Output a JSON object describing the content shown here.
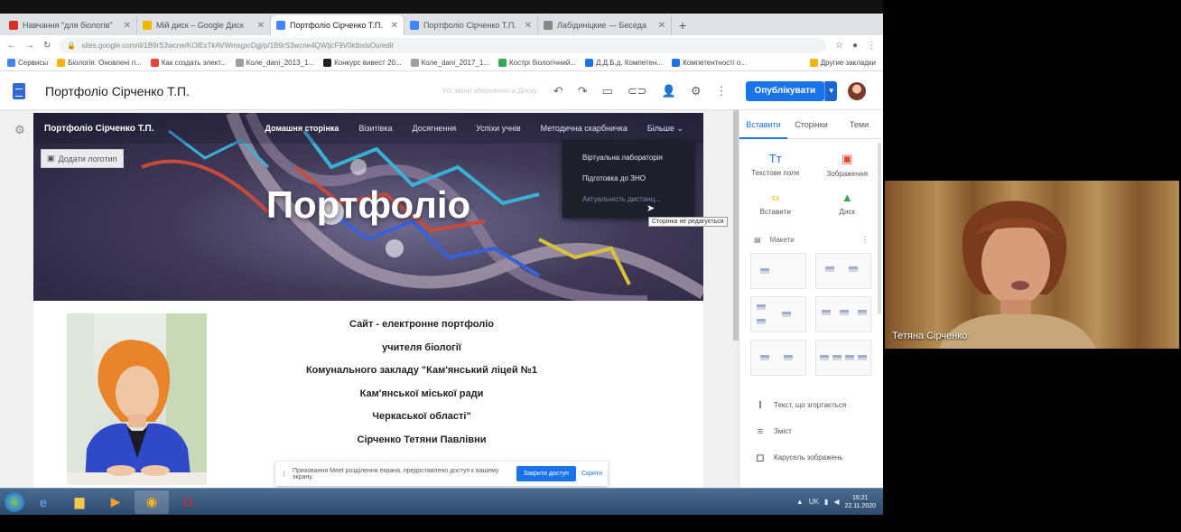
{
  "browser": {
    "tabs": [
      {
        "label": "Навчання \"для біологів\"",
        "color": "#d93025",
        "active": false
      },
      {
        "label": "Мій диск – Google Диск",
        "color": "#f4b400",
        "active": false
      },
      {
        "label": "Портфоліо Сірченко Т.П.",
        "color": "#4285f4",
        "active": true
      },
      {
        "label": "Портфоліо Сірченко Т.П.",
        "color": "#4285f4",
        "active": false
      },
      {
        "label": "Лабідиніцкие — Беседа",
        "color": "#888888",
        "active": false
      }
    ],
    "url": "sites.google.com/d/1B9rS3wcne/KOlExTkAVWmsgxrDgj/p/1B9rS3wcne4QWtjcF9V0ktbxlsOu/edit",
    "bookmarks": [
      "Сервисы",
      "Біологія. Оновлені п...",
      "Как создать элект...",
      "Коле_danі_2013_1...",
      "Конкурс вивест 20...",
      "Коле_danі_2017_1...",
      "Кострі біологічний...",
      "Д.Д.Б.д. Компетен...",
      "Компетентності о...",
      "Другие закладки"
    ]
  },
  "sites_toolbar": {
    "title": "Портфоліо Сірченко Т.П.",
    "draft_info": "Усі зміни збережено в Диску",
    "publish_label": "Опублікувати"
  },
  "site_header": {
    "brand": "Портфоліо Сірченко Т.П.",
    "nav": [
      "Домашня сторінка",
      "Візитівка",
      "Досягнення",
      "Успіхи учнів",
      "Методична скарбничка",
      "Більше"
    ],
    "add_logo": "Додати логотип",
    "hero_title": "Портфоліо"
  },
  "dropdown": {
    "items": [
      "Віртуальна лабораторія",
      "Підготовка до ЗНО",
      "Актуальність дистанц..."
    ],
    "tooltip": "Сторінка не редагується"
  },
  "content": {
    "lines": [
      "Сайт - електронне портфоліо",
      "учителя біології",
      "Комунального закладу \"Кам'янський ліцей №1",
      "Кам'янської міської ради",
      "Черкаської області\"",
      "Сірченко Тетяни Павлівни"
    ]
  },
  "notice": {
    "text": "Приховання Meet розділення екрана, предоставлено доступ к вашему экрану.",
    "button": "Закрити доступ",
    "hide": "Скрити"
  },
  "panel": {
    "tabs": [
      "Вставити",
      "Сторінки",
      "Теми"
    ],
    "insert_items": [
      {
        "icon": "Tт",
        "label": "Текстове поле"
      },
      {
        "icon": "▣",
        "label": "Зображення"
      },
      {
        "icon": "‹›",
        "label": "Вставити"
      },
      {
        "icon": "▲",
        "label": "Диск"
      }
    ],
    "layouts_label": "Макети",
    "list": [
      {
        "icon": "Ⅰ",
        "label": "Текст, що згортається"
      },
      {
        "icon": "≡",
        "label": "Зміст"
      },
      {
        "icon": "◻",
        "label": "Карусель зображень"
      }
    ]
  },
  "taskbar": {
    "lang": "UK",
    "time": "16:21",
    "date": "22.11.2020"
  },
  "video": {
    "participant": "Тетяна Сірченко"
  },
  "colors": {
    "accent": "#1a73e8",
    "taskbar": "#2c4a6e"
  }
}
